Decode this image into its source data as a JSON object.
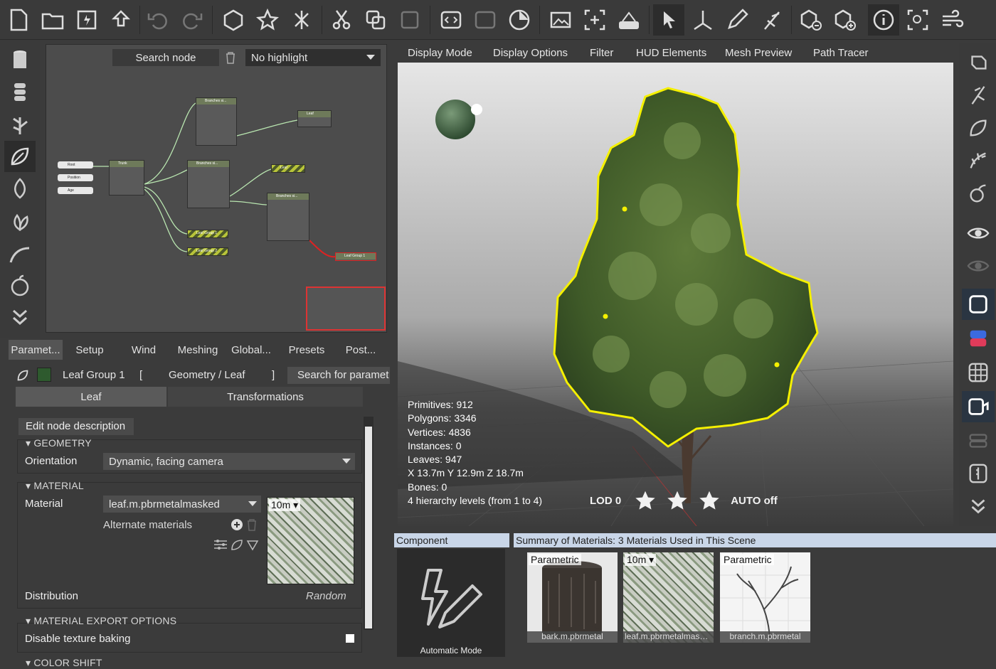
{
  "graph": {
    "search_placeholder": "Search node",
    "highlight": "No highlight",
    "nodes": {
      "root": "Root",
      "position": "Position",
      "age": "Age",
      "trunk": "Trunk",
      "branches1": "Branches si...",
      "branches2": "Branches si...",
      "branches3": "Branches si...",
      "leaf1": "Leaf",
      "leaf2": "Leaf",
      "leafgroup1": "Leaf Group 1",
      "leafgroup2": "Leaf Group 2",
      "leafgroup3": "Leaf Group 1"
    }
  },
  "param_tabs": [
    "Paramet...",
    "Setup",
    "Wind",
    "Meshing",
    "Global...",
    "Presets",
    "Post..."
  ],
  "node_header": {
    "name": "Leaf Group 1",
    "bracket_open": "[",
    "path": "Geometry / Leaf",
    "bracket_close": "]",
    "search_placeholder": "Search for paramet"
  },
  "subtabs": [
    "Leaf",
    "Transformations"
  ],
  "panel": {
    "edit_desc": "Edit node description",
    "geometry_title": "GEOMETRY",
    "orientation_label": "Orientation",
    "orientation_value": "Dynamic, facing camera",
    "material_title": "MATERIAL",
    "material_label": "Material",
    "material_value": "leaf.m.pbrmetalmasked",
    "thumb_size": "10m",
    "alternate_materials": "Alternate materials",
    "distribution_label": "Distribution",
    "distribution_value": "Random",
    "export_title": "MATERIAL EXPORT OPTIONS",
    "disable_baking": "Disable texture baking",
    "color_shift_title": "COLOR SHIFT"
  },
  "viewport_menu": [
    "Display Mode",
    "Display Options",
    "Filter",
    "HUD Elements",
    "Mesh Preview",
    "Path Tracer"
  ],
  "stats": {
    "primitives": "Primitives: 912",
    "polygons": "Polygons: 3346",
    "vertices": "Vertices: 4836",
    "instances": "Instances: 0",
    "leaves": "Leaves: 947",
    "dims": "X 13.7m Y 12.9m Z 18.7m",
    "bones": "Bones: 0",
    "hierarchy": "4 hierarchy levels (from 1 to 4)"
  },
  "lod": {
    "label": "LOD 0",
    "auto": "AUTO off",
    "stars_filled": 3,
    "stars_total": 3
  },
  "bottom": {
    "component_title": "Component",
    "component_caption": "Automatic Mode",
    "materials_title": "Summary of Materials: 3 Materials Used in This Scene",
    "materials": [
      {
        "tag": "Parametric",
        "name": "bark.m.pbrmetal"
      },
      {
        "tag": "10m",
        "name": "leaf.m.pbrmetalmasked"
      },
      {
        "tag": "Parametric",
        "name": "branch.m.pbrmetal"
      }
    ]
  },
  "colors": {
    "selection_outline": "#f5f000",
    "accent": "#2a3542",
    "header_blue": "#c9d6e8"
  }
}
